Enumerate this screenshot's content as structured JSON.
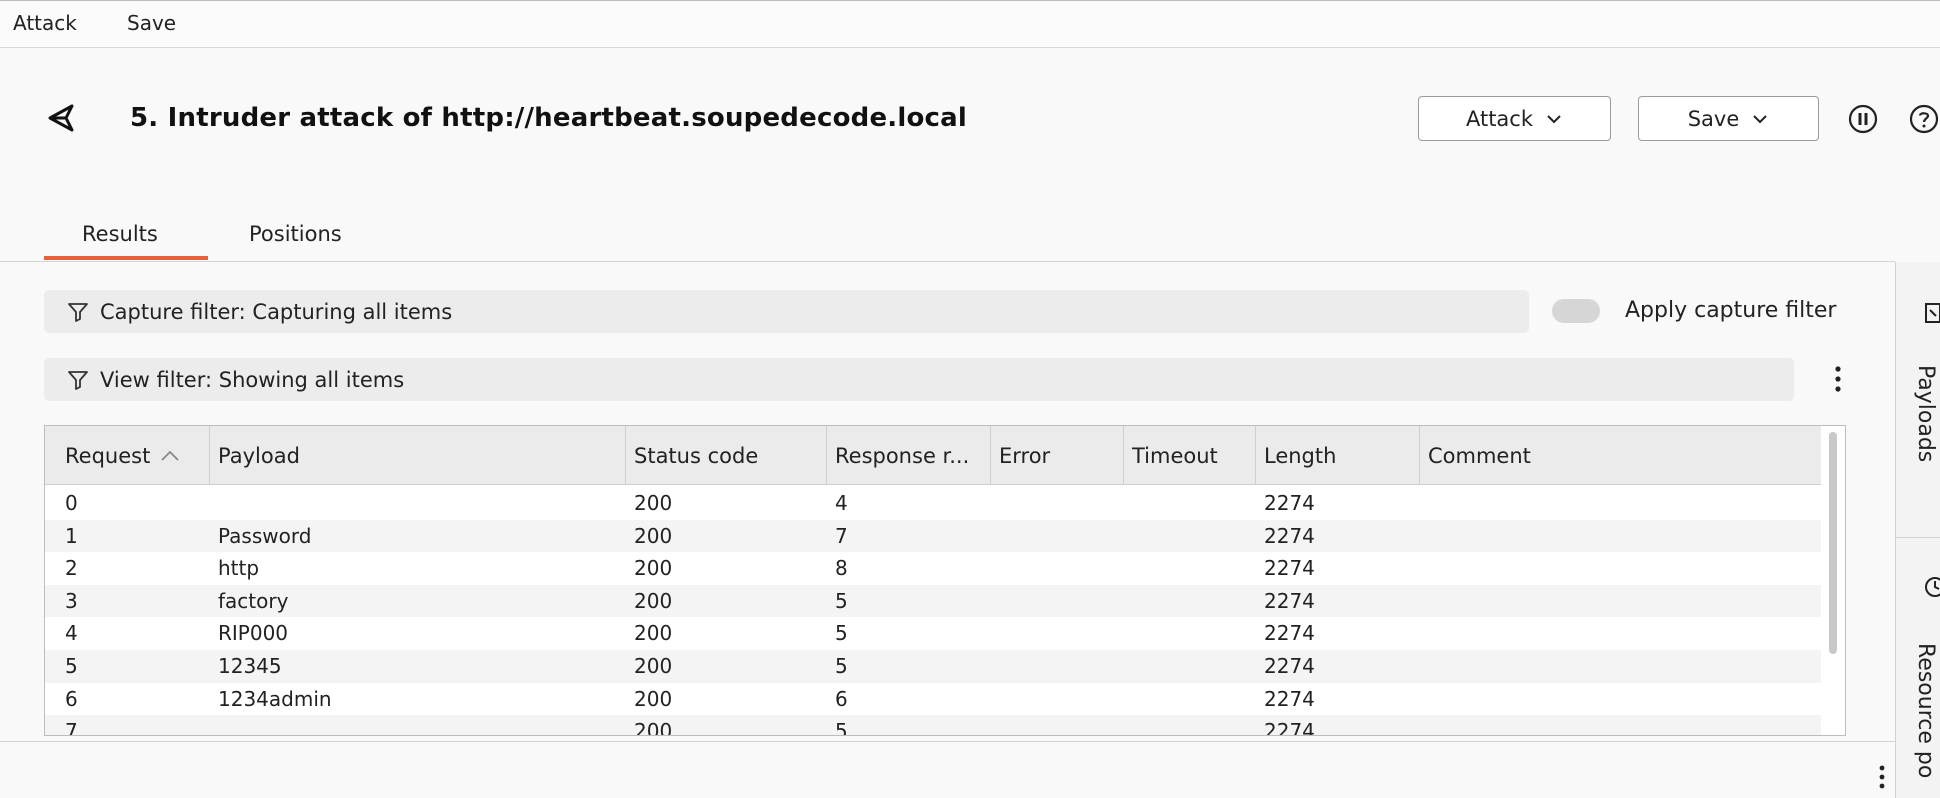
{
  "menubar": {
    "items": [
      "Attack",
      "Save"
    ]
  },
  "header": {
    "title": "5. Intruder attack of http://heartbeat.soupedecode.local",
    "attack_button": "Attack",
    "save_button": "Save"
  },
  "tabs": [
    {
      "label": "Results",
      "active": true
    },
    {
      "label": "Positions",
      "active": false
    }
  ],
  "capture_filter": {
    "label": "Capture filter: Capturing all items",
    "toggle_label": "Apply capture filter",
    "toggle_on": false
  },
  "view_filter": {
    "label": "View filter: Showing all items"
  },
  "table": {
    "columns": [
      "Request",
      "Payload",
      "Status code",
      "Response r...",
      "Error",
      "Timeout",
      "Length",
      "Comment"
    ],
    "sort_column": "Request",
    "rows": [
      {
        "request": "0",
        "payload": "",
        "status": "200",
        "response": "4",
        "error": "",
        "timeout": "",
        "length": "2274",
        "comment": ""
      },
      {
        "request": "1",
        "payload": "Password",
        "status": "200",
        "response": "7",
        "error": "",
        "timeout": "",
        "length": "2274",
        "comment": ""
      },
      {
        "request": "2",
        "payload": "http",
        "status": "200",
        "response": "8",
        "error": "",
        "timeout": "",
        "length": "2274",
        "comment": ""
      },
      {
        "request": "3",
        "payload": "factory",
        "status": "200",
        "response": "5",
        "error": "",
        "timeout": "",
        "length": "2274",
        "comment": ""
      },
      {
        "request": "4",
        "payload": "RIP000",
        "status": "200",
        "response": "5",
        "error": "",
        "timeout": "",
        "length": "2274",
        "comment": ""
      },
      {
        "request": "5",
        "payload": "12345",
        "status": "200",
        "response": "5",
        "error": "",
        "timeout": "",
        "length": "2274",
        "comment": ""
      },
      {
        "request": "6",
        "payload": "1234admin",
        "status": "200",
        "response": "6",
        "error": "",
        "timeout": "",
        "length": "2274",
        "comment": ""
      },
      {
        "request": "7",
        "payload": "",
        "status": "200",
        "response": "5",
        "error": "",
        "timeout": "",
        "length": "2274",
        "comment": ""
      }
    ]
  },
  "side_panel": {
    "items": [
      {
        "label": "Payloads",
        "icon": "payloads-icon"
      },
      {
        "label": "Resource po",
        "icon": "resource-pool-icon"
      }
    ]
  },
  "colors": {
    "accent": "#e8613a"
  }
}
